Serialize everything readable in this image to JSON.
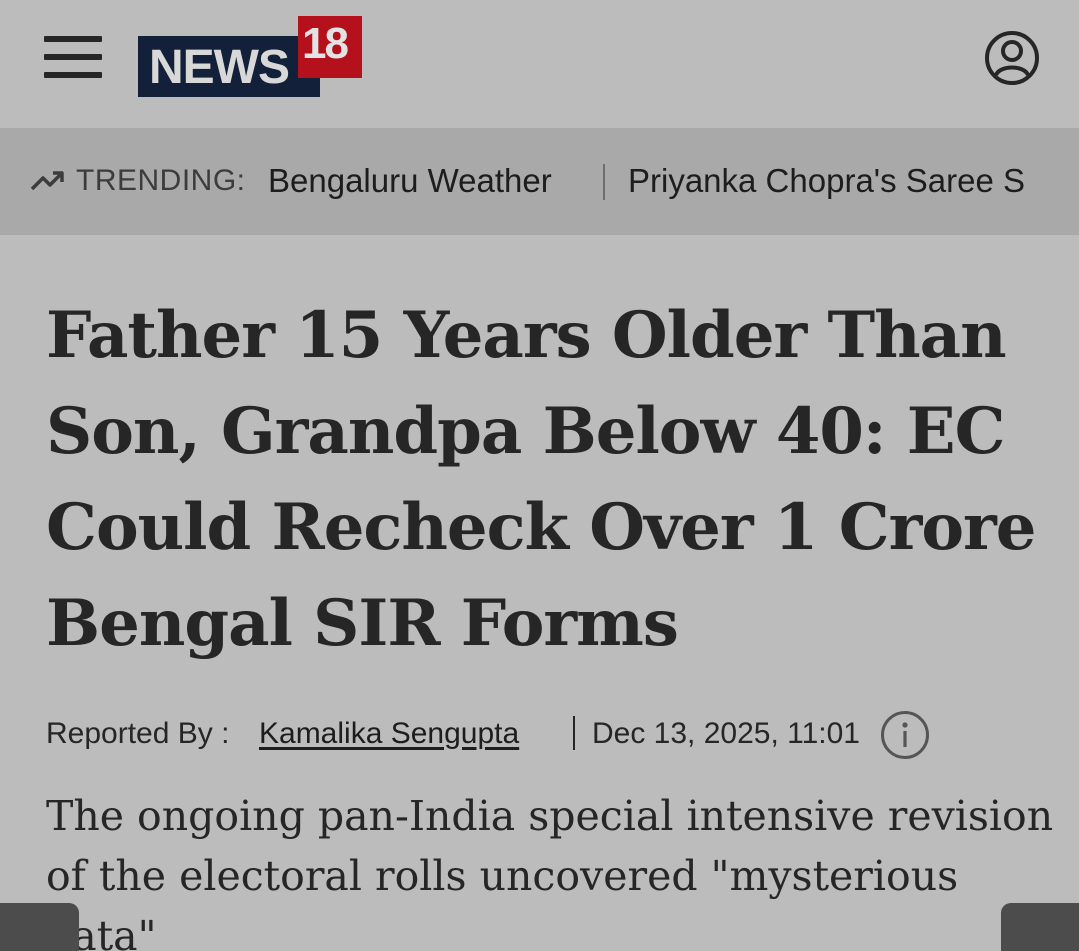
{
  "header": {
    "logo_main": "NEWS",
    "logo_number": "18",
    "menu_icon": "hamburger-menu-icon",
    "account_icon": "user-account-icon"
  },
  "trending": {
    "icon": "trending-up-icon",
    "label": "TRENDING:",
    "items": [
      "Bengaluru Weather",
      "Priyanka Chopra's Saree S"
    ]
  },
  "article": {
    "headline": "Father 15 Years Older Than Son, Grandpa Below 40: EC Could Recheck Over 1 Crore Bengal SIR Forms",
    "byline_prefix": "Reported By :",
    "author": "Kamalika Sengupta",
    "timestamp": "Dec 13, 2025, 11:01",
    "info_icon": "info-icon",
    "summary": "The ongoing pan-India special intensive revision of the electoral rolls uncovered \"mysterious data\""
  },
  "colors": {
    "background": "#bcbcbc",
    "trending_bar": "#a9a9a9",
    "logo_navy": "#132039",
    "logo_red": "#b4111c",
    "text": "#262626"
  }
}
